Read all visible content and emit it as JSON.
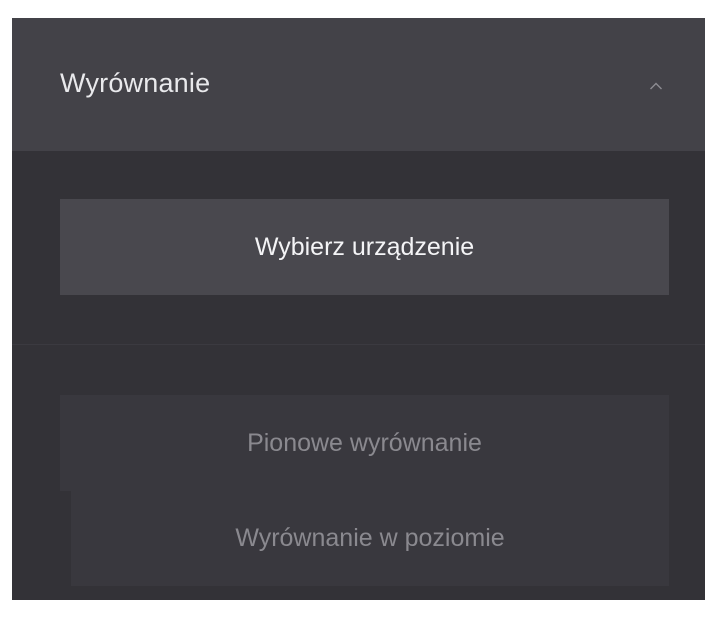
{
  "section": {
    "title": "Wyrównanie",
    "expanded": true,
    "toggle_icon": "chevron-up-icon"
  },
  "actions": {
    "select_device_label": "Wybierz urządzenie",
    "vertical_align_label": "Pionowe wyrównanie",
    "horizontal_align_label": "Wyrównanie w poziomie"
  },
  "colors": {
    "panel_bg": "#333237",
    "header_bg": "#434248",
    "button_bg": "#49484e",
    "disabled_button_bg": "#39383e",
    "text_primary": "#f4f4f6",
    "text_disabled": "#8a898f"
  }
}
